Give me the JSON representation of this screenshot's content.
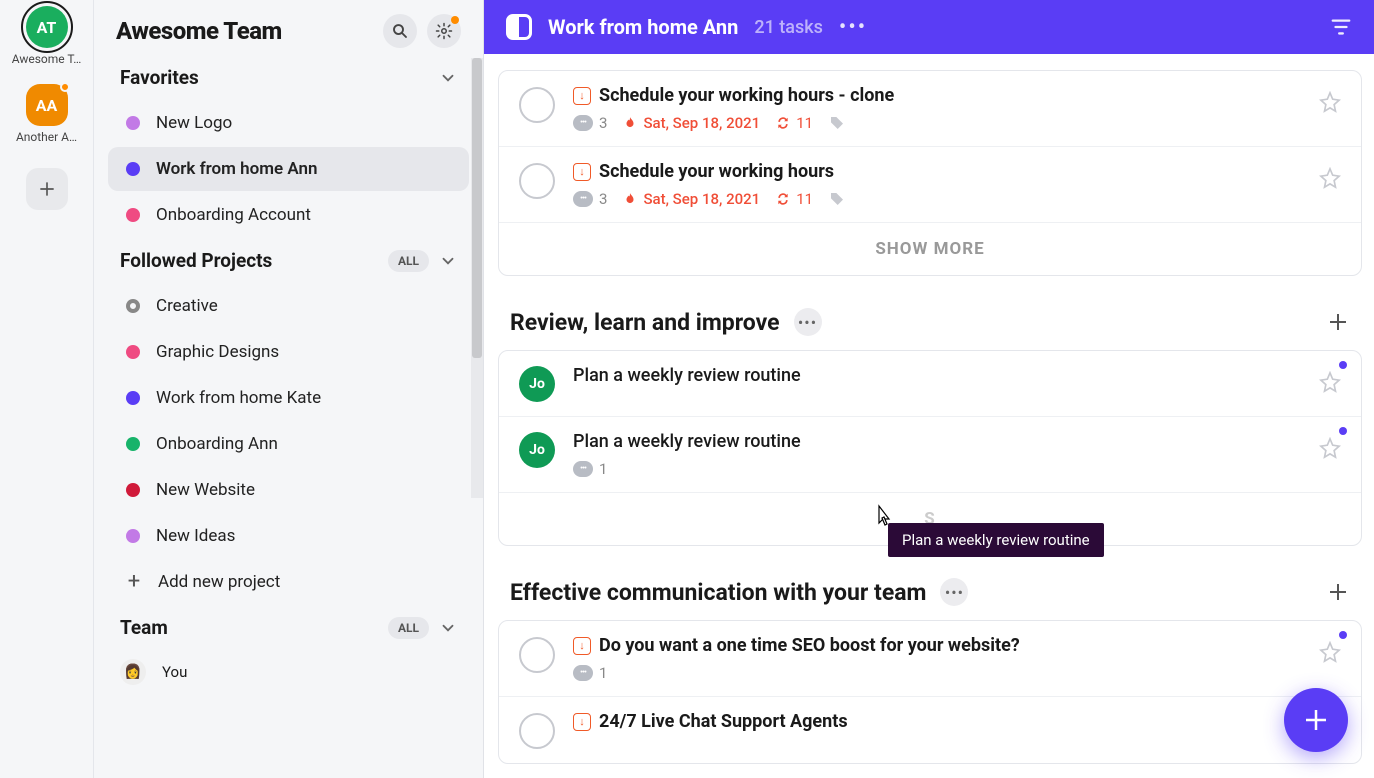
{
  "rail": {
    "teams": [
      {
        "initials": "AT",
        "label": "Awesome T…",
        "color": "#1aae5e",
        "selected": true,
        "notif": false
      },
      {
        "initials": "AA",
        "label": "Another A…",
        "color": "#f08a00",
        "selected": false,
        "notif": true
      }
    ]
  },
  "workspace": {
    "title": "Awesome Team"
  },
  "sidebar": {
    "favorites_label": "Favorites",
    "favorites": [
      {
        "label": "New Logo",
        "color": "#c27ae6"
      },
      {
        "label": "Work from home Ann",
        "color": "#5a3df5",
        "active": true
      },
      {
        "label": "Onboarding Account",
        "color": "#ef4b82"
      }
    ],
    "followed_label": "Followed Projects",
    "followed_filter": "ALL",
    "followed": [
      {
        "label": "Creative",
        "color": "ring"
      },
      {
        "label": "Graphic Designs",
        "color": "#ef4b82"
      },
      {
        "label": "Work from home Kate",
        "color": "#5a3df5"
      },
      {
        "label": "Onboarding Ann",
        "color": "#17b36a"
      },
      {
        "label": "New Website",
        "color": "#d01a3a"
      },
      {
        "label": "New Ideas",
        "color": "#c27ae6"
      }
    ],
    "add_project_label": "Add new project",
    "team_label": "Team",
    "team_filter": "ALL",
    "members": [
      {
        "name": "You"
      }
    ]
  },
  "header": {
    "project_title": "Work from home Ann",
    "task_count": "21 tasks"
  },
  "groups": [
    {
      "tasks": [
        {
          "title": "Schedule your working hours - clone",
          "bold": true,
          "priority": true,
          "comments": "3",
          "due": "Sat, Sep 18, 2021",
          "recur": "11",
          "tag": true,
          "checkbox": true
        },
        {
          "title": "Schedule your working hours",
          "bold": true,
          "priority": true,
          "comments": "3",
          "due": "Sat, Sep 18, 2021",
          "recur": "11",
          "tag": true,
          "checkbox": true
        }
      ],
      "show_more": "SHOW MORE"
    },
    {
      "title": "Review, learn and improve",
      "tasks": [
        {
          "title": "Plan a weekly review routine",
          "assignee": {
            "label": "Jo",
            "color": "#0f9a55"
          },
          "unseen": true
        },
        {
          "title": "Plan a weekly review routine",
          "assignee": {
            "label": "Jo",
            "color": "#0f9a55"
          },
          "comments": "1",
          "unseen": true
        }
      ],
      "show_more_hidden": "S"
    },
    {
      "title": "Effective communication with your team",
      "tasks": [
        {
          "title": "Do you want a one time SEO boost for your website?",
          "bold": true,
          "priority": true,
          "comments": "1",
          "checkbox": true,
          "unseen": true
        },
        {
          "title": "24/7 Live Chat Support Agents",
          "bold": true,
          "priority": true,
          "checkbox": true
        }
      ]
    }
  ],
  "tooltip": "Plan a weekly review routine"
}
